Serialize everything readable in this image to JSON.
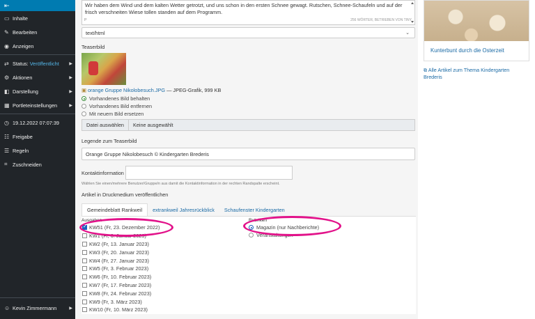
{
  "sidebar": {
    "toggle_icon": "collapse-icon",
    "items": [
      {
        "icon": "folder-icon",
        "label": "Inhalte",
        "arrow": false
      },
      {
        "icon": "pencil-icon",
        "label": "Bearbeiten",
        "arrow": false
      },
      {
        "icon": "eye-icon",
        "label": "Anzeigen",
        "arrow": false
      },
      {
        "icon": "status-icon",
        "label": "Status:",
        "value": "Veröffentlicht",
        "arrow": true
      },
      {
        "icon": "gear-icon",
        "label": "Aktionen",
        "arrow": true
      },
      {
        "icon": "display-icon",
        "label": "Darstellung",
        "arrow": true
      },
      {
        "icon": "portlet-icon",
        "label": "Portleteinstellungen",
        "arrow": true
      },
      {
        "icon": "clock-icon",
        "label": "19.12.2022 07:07:39",
        "arrow": false
      },
      {
        "icon": "people-icon",
        "label": "Freigabe",
        "arrow": false
      },
      {
        "icon": "rules-icon",
        "label": "Regeln",
        "arrow": false
      },
      {
        "icon": "crop-icon",
        "label": "Zuschneiden",
        "arrow": false
      }
    ],
    "user": "Kevin Zimmermann"
  },
  "editor": {
    "text": "Wir haben dem Wind und dem kalten Wetter getrotzt, und uns schon in den ersten Schnee gewagt. Rutschen, Schnee-Schaufeln und auf der frisch verschneiten Wiese tollen standen auf dem Programm.",
    "path": "P",
    "wordcount": "256 WÖRTER, BETRIEBEN VON TINY"
  },
  "format_select": "text/html",
  "teaser": {
    "label": "Teaserbild",
    "file_name": "orange Gruppe Nikolobesuch.JPG",
    "file_meta": "— JPEG-Grafik, 999 KB",
    "options": [
      "Vorhandenes Bild behalten",
      "Vorhandenes Bild entfernen",
      "Mit neuem Bild ersetzen"
    ],
    "selected": 0,
    "file_button": "Datei auswählen",
    "file_none": "Keine ausgewählt"
  },
  "caption": {
    "label": "Legende zum Teaserbild",
    "value": "Orange Gruppe Nikolobesuch © Kindergarten Brederis"
  },
  "kontakt": {
    "label": "Kontaktinformation",
    "hint": "Wählen Sie einen/mehrere Benutzer/Gruppe/n aus damit die Kontaktinformation in der rechten Randspalte erscheint."
  },
  "print": {
    "label": "Artikel in Druckmedium veröffentlichen",
    "tabs": [
      "Gemeindeblatt Rankweil",
      "extrankweil Jahresrückblick",
      "Schaufenster Kindergarten"
    ],
    "left_heading": "Ausgaben",
    "right_heading": "Rubriken",
    "issues": [
      {
        "label": "KW51 (Fr, 23. Dezember 2022)",
        "checked": true
      },
      {
        "label": "KW1 (Fr, 6. Januar 2023)",
        "checked": false
      },
      {
        "label": "KW2 (Fr, 13. Januar 2023)",
        "checked": false
      },
      {
        "label": "KW3 (Fr, 20. Januar 2023)",
        "checked": false
      },
      {
        "label": "KW4 (Fr, 27. Januar 2023)",
        "checked": false
      },
      {
        "label": "KW5 (Fr, 3. Februar 2023)",
        "checked": false
      },
      {
        "label": "KW6 (Fr, 10. Februar 2023)",
        "checked": false
      },
      {
        "label": "KW7 (Fr, 17. Februar 2023)",
        "checked": false
      },
      {
        "label": "KW8 (Fr, 24. Februar 2023)",
        "checked": false
      },
      {
        "label": "KW9 (Fr, 3. März 2023)",
        "checked": false
      },
      {
        "label": "KW10 (Fr, 10. März 2023)",
        "checked": false
      }
    ],
    "rubrics": [
      {
        "label": "Magazin (nur Nachberichte)",
        "checked": true
      },
      {
        "label": "Veranstaltungen",
        "checked": false
      }
    ]
  },
  "right": {
    "card_title": "Kunterbunt durch die Osterzeit",
    "all_link": "Alle Artikel zum Thema Kindergarten Brederis"
  }
}
